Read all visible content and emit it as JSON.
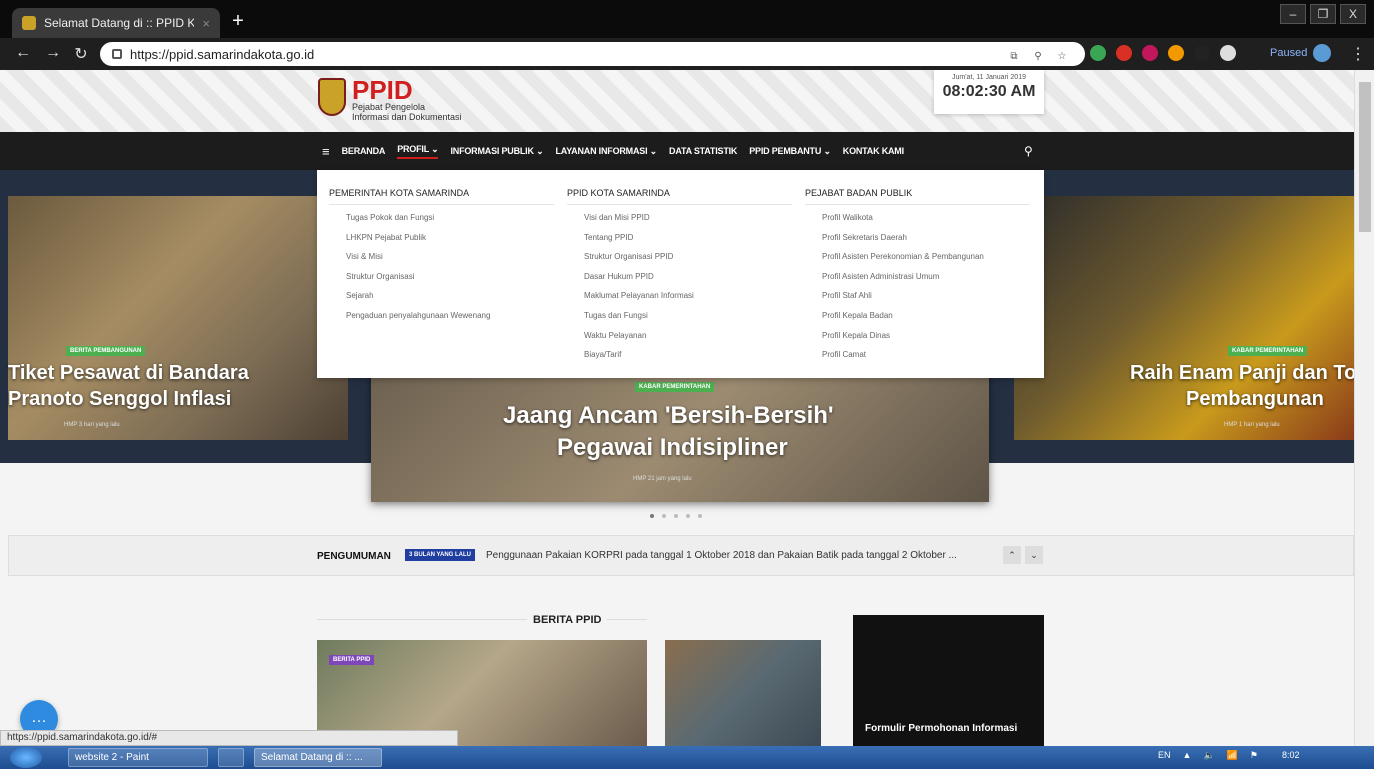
{
  "browser": {
    "tab_title": "Selamat Datang di :: PPID KOTA",
    "tab_close": "×",
    "new_tab": "+",
    "url": "https://ppid.samarindakota.go.id",
    "profile_status": "Paused",
    "window_controls": [
      "–",
      "❐",
      "X"
    ]
  },
  "header": {
    "logo_text": "PPID",
    "logo_sub1": "Pejabat Pengelola",
    "logo_sub2": "Informasi dan Dokumentasi",
    "clock_date": "Jum'at, 11 Januari 2019",
    "clock_time": "08:02:30 AM"
  },
  "nav": {
    "items": [
      "BERANDA",
      "PROFIL ⌄",
      "INFORMASI PUBLIK ⌄",
      "LAYANAN INFORMASI ⌄",
      "DATA STATISTIK",
      "PPID PEMBANTU ⌄",
      "KONTAK KAMI"
    ],
    "menu_icon": "≡",
    "search_icon": "⚲"
  },
  "dropdown": {
    "col1": {
      "heading": "PEMERINTAH KOTA SAMARINDA",
      "items": [
        "Tugas Pokok dan Fungsi",
        "LHKPN Pejabat Publik",
        "Visi & Misi",
        "Struktur Organisasi",
        "Sejarah",
        "Pengaduan penyalahgunaan Wewenang"
      ]
    },
    "col2": {
      "heading": "PPID KOTA SAMARINDA",
      "items": [
        "Visi dan Misi PPID",
        "Tentang PPID",
        "Struktur Organisasi PPID",
        "Dasar Hukum PPID",
        "Maklumat Pelayanan Informasi",
        "Tugas dan Fungsi",
        "Waktu Pelayanan",
        "Biaya/Tarif"
      ]
    },
    "col3": {
      "heading": "PEJABAT BADAN PUBLIK",
      "items": [
        "Profil Walikota",
        "Profil Sekretaris Daerah",
        "Profil Asisten Perekonomian & Pembangunan",
        "Profil Asisten Administrasi Umum",
        "Profil Staf Ahli",
        "Profil Kepala Badan",
        "Profil Kepala Dinas",
        "Profil Camat"
      ]
    }
  },
  "slides": {
    "left": {
      "tag": "BERITA PEMBANGUNAN",
      "title1": "Tiket Pesawat di Bandara",
      "title2": "Pranoto Senggol Inflasi",
      "meta": "HMP  3 hari yang lalu"
    },
    "center": {
      "tag": "KABAR PEMERINTAHAN",
      "title1": "Jaang Ancam 'Bersih-Bersih'",
      "title2": "Pegawai Indisipliner",
      "meta": "HMP  21 jam yang lalu"
    },
    "right": {
      "tag": "KABAR PEMERINTAHAN",
      "title1": "Raih Enam Panji dan To",
      "title2": "Pembangunan",
      "meta": "HMP  1 hari yang lalu"
    }
  },
  "announcement": {
    "label": "PENGUMUMAN",
    "badge": "3 BULAN YANG LALU",
    "text": "Penggunaan Pakaian KORPRI pada tanggal 1 Oktober 2018 dan Pakaian Batik pada tanggal 2 Oktober ...",
    "up": "⌃",
    "down": "⌄"
  },
  "news": {
    "section_title": "BERITA PPID",
    "tag": "BERITA PPID",
    "form_title": "Formulir Permohonan Informasi"
  },
  "status_url": "https://ppid.samarindakota.go.id/#",
  "taskbar": {
    "task1": "website 2 - Paint",
    "task2": "Selamat Datang di :: ...",
    "lang": "EN",
    "time": "8:02"
  },
  "colors": {
    "brand_red": "#d01f1f",
    "nav_bg": "#1c1c1c",
    "badge_blue": "#1f3ea0",
    "tag_green": "#4caf50"
  }
}
